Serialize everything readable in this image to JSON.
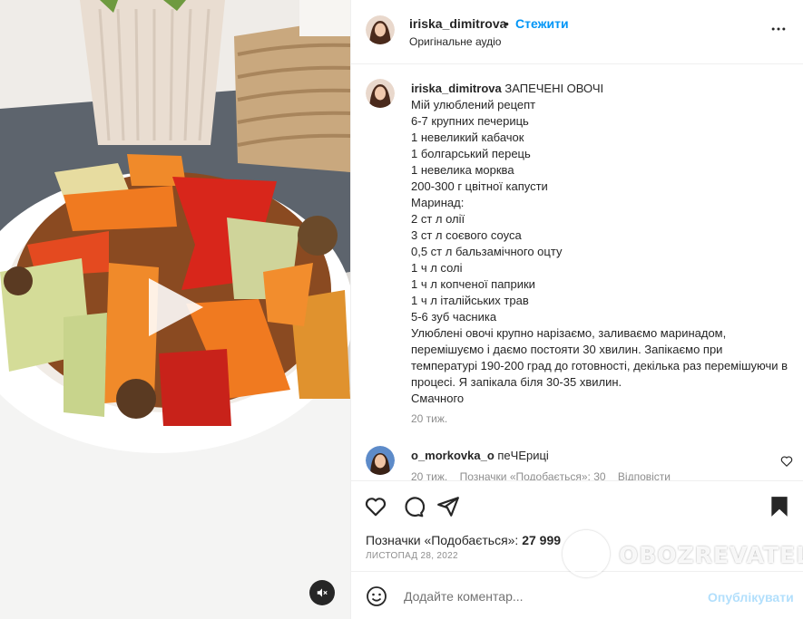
{
  "post": {
    "author": "iriska_dimitrova",
    "separator": "•",
    "follow_label": "Стежити",
    "audio_label": "Оригінальне аудіо"
  },
  "caption": {
    "title": "ЗАПЕЧЕНІ ОВОЧІ",
    "lines": [
      "Мій улюблений рецепт⁣",
      "⁣6-7 крупних печериць",
      "⁣1 невеликий кабачок",
      "⁣1 болгарський перець",
      "⁣1 невелика морква",
      "⁣200-300 г цвітної капусти",
      "Маринад:",
      "⁣2 ст л олії",
      "⁣3 ст л соєвого соуса",
      "⁣0,5 ст л бальзамічного оцту",
      "⁣1 ч л солі",
      "⁣1 ч л копченої паприки",
      "⁣1 ч л італійських трав",
      "⁣5-6 зуб часника"
    ],
    "paragraph": "Улюблені овочі крупно нарізаємо, заливаємо маринадом, перемішуємо і даємо постояти 30 хвилин. Запікаємо при температурі 190-200 град до готовності, декілька раз перемішуючи в процесі. Я запікала біля 30-35 хвилин.",
    "closing": "Смачного⁣",
    "time": "20 тиж."
  },
  "comment": {
    "author": "o_morkovka_o",
    "text": "пеЧЕриці⁣",
    "time": "20 тиж.",
    "likes": "Позначки «Подобається»: 30",
    "reply": "Відповісти"
  },
  "actions": {
    "likes_prefix": "Позначки «Подобається»:",
    "likes_count": "27 999",
    "date": "ЛИСТОПАД 28, 2022"
  },
  "comment_box": {
    "placeholder": "Додайте коментар...",
    "post_label": "Опублікувати"
  },
  "watermark": {
    "text": "OBOZREVATEL"
  },
  "colors": {
    "accent": "#0095f6",
    "post_disabled": "#b2dffc",
    "muted": "#8e8e8e"
  },
  "icons": [
    "more-icon",
    "heart-icon",
    "comment-icon",
    "share-icon",
    "bookmark-icon",
    "emoji-icon",
    "play-icon",
    "mute-icon"
  ]
}
